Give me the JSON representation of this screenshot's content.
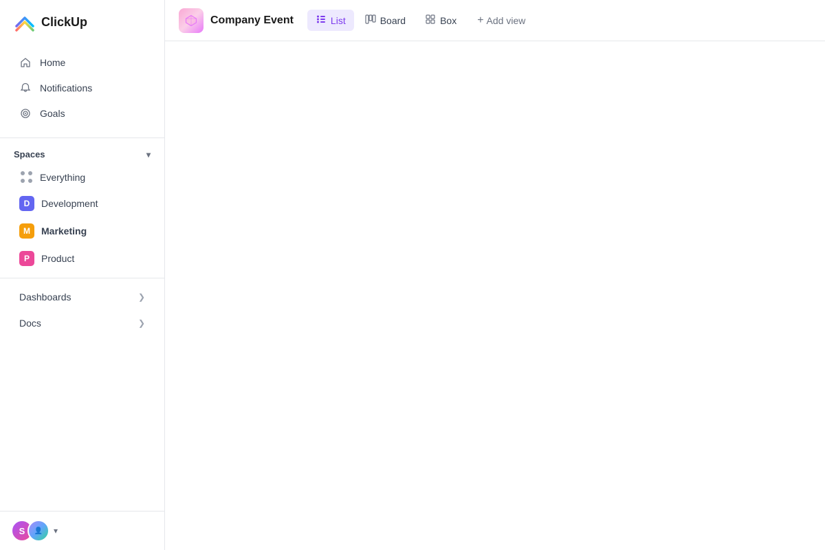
{
  "app": {
    "name": "ClickUp"
  },
  "sidebar": {
    "nav": [
      {
        "id": "home",
        "label": "Home",
        "icon": "home"
      },
      {
        "id": "notifications",
        "label": "Notifications",
        "icon": "bell"
      },
      {
        "id": "goals",
        "label": "Goals",
        "icon": "goal"
      }
    ],
    "spaces_label": "Spaces",
    "spaces": [
      {
        "id": "everything",
        "label": "Everything",
        "type": "dots"
      },
      {
        "id": "development",
        "label": "Development",
        "type": "avatar",
        "letter": "D",
        "color": "#6366f1"
      },
      {
        "id": "marketing",
        "label": "Marketing",
        "type": "avatar",
        "letter": "M",
        "color": "#f59e0b",
        "active": true
      },
      {
        "id": "product",
        "label": "Product",
        "type": "avatar",
        "letter": "P",
        "color": "#ec4899"
      }
    ],
    "sections": [
      {
        "id": "dashboards",
        "label": "Dashboards"
      },
      {
        "id": "docs",
        "label": "Docs"
      }
    ]
  },
  "topbar": {
    "workspace_title": "Company Event",
    "tabs": [
      {
        "id": "list",
        "label": "List",
        "icon": "list",
        "active": true
      },
      {
        "id": "board",
        "label": "Board",
        "icon": "board",
        "active": false
      },
      {
        "id": "box",
        "label": "Box",
        "icon": "box",
        "active": false
      }
    ],
    "add_view_label": "Add view"
  }
}
